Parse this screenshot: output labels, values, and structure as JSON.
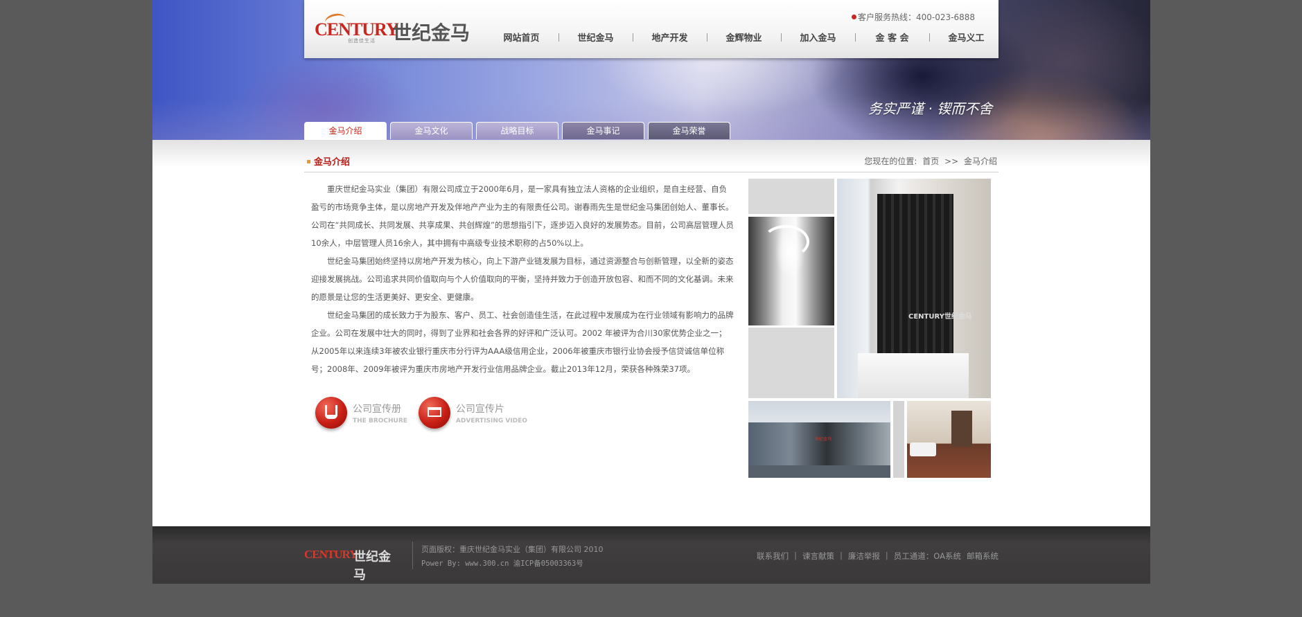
{
  "header": {
    "logo_en": "CENTURY",
    "logo_cn": "世纪金马",
    "logo_sub": "创造佳生活",
    "hotline": "客户服务热线：400-023-6888",
    "nav": [
      "网站首页",
      "世纪金马",
      "地产开发",
      "金辉物业",
      "加入金马",
      "金 客 会",
      "金马义工"
    ]
  },
  "banner": {
    "slogan": "务实严谨 · 锲而不舍",
    "tabs": [
      "金马介绍",
      "金马文化",
      "战略目标",
      "金马事记",
      "金马荣誉"
    ],
    "active_tab": 0
  },
  "section": {
    "title": "金马介绍",
    "breadcrumb_label": "您现在的位置:",
    "breadcrumb_home": "首页",
    "breadcrumb_sep": ">>",
    "breadcrumb_current": "金马介绍"
  },
  "article": [
    "重庆世纪金马实业（集团）有限公司成立于2000年6月，是一家具有独立法人资格的企业组织，是自主经营、自负盈亏的市场竞争主体，是以房地产开发及伴地产产业为主的有限责任公司。谢春雨先生是世纪金马集团创始人、董事长。公司在“共同成长、共同发展、共享成果、共创辉煌”的思想指引下，逐步迈入良好的发展势态。目前，公司高层管理人员10余人，中层管理人员16余人，其中拥有中高级专业技术职称的占50%以上。",
    "世纪金马集团始终坚持以房地产开发为核心，向上下游产业链发展为目标，通过资源整合与创新管理，以全新的姿态迎接发展挑战。公司追求共同价值取向与个人价值取向的平衡，坚持并致力于创造开放包容、和而不同的文化基调。未来的愿景是让您的生活更美好、更安全、更健康。",
    "世纪金马集团的成长致力于为股东、客户、员工、社会创造佳生活，在此过程中发展成为在行业领域有影响力的品牌企业。公司在发展中壮大的同时，得到了业界和社会各界的好评和广泛认可。2002 年被评为合川30家优势企业之一；从2005年以来连续3年被农业银行重庆市分行评为AAA级信用企业，2006年被重庆市银行业协会授予信贷诚信单位称号；2008年、2009年被评为重庆市房地产开发行业信用品牌企业。截止2013年12月，荣获各种殊荣37项。"
  ],
  "promo": [
    {
      "cn": "公司宣传册",
      "en": "THE BROCHURE",
      "icon": "brochure-icon"
    },
    {
      "cn": "公司宣传片",
      "en": "ADVERTISING VIDEO",
      "icon": "video-icon"
    }
  ],
  "photos": {
    "lobby_sign": "CENTURY世纪金马",
    "building_sign": "世纪金马"
  },
  "footer": {
    "logo_en": "CENTURY",
    "logo_cn": "世纪金马",
    "copyright": "页面版权：重庆世纪金马实业（集团）有限公司 2010",
    "power": "Power By: www.300.cn 渝ICP备05003363号",
    "links": [
      "联系我们",
      "谏言献策",
      "廉洁举报",
      "员工通道：OA系统",
      "邮箱系统"
    ]
  },
  "colors": {
    "brand_red": "#c8261e",
    "accent_orange": "#e89a2a",
    "page_bg": "#5a5a5a",
    "footer_bg": "#3a3838"
  }
}
